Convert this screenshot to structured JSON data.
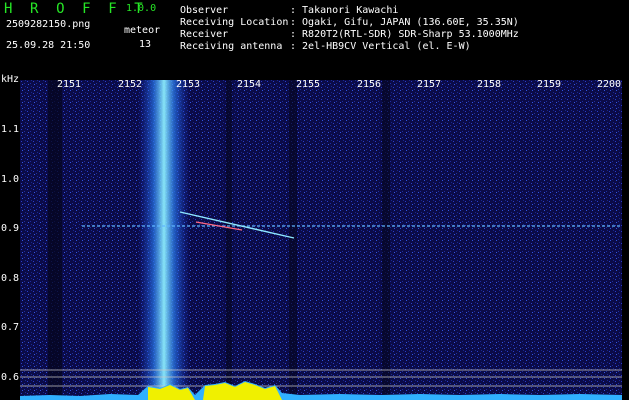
{
  "app": {
    "title": "H R O F F T",
    "version": "1.0.0"
  },
  "capture": {
    "filename": "2509282150.png",
    "timestamp": "25.09.28 21:50",
    "mode_label": "meteor",
    "count": "13"
  },
  "station": {
    "labels": [
      "Observer",
      "Receiving Location",
      "Receiver",
      "Receiving antenna"
    ],
    "values": [
      ": Takanori Kawachi",
      ": Ogaki, Gifu, JAPAN (136.60E, 35.35N)",
      ": R820T2(RTL-SDR) SDR-Sharp 53.1000MHz",
      ": 2el-HB9CV Vertical (el. E-W)"
    ]
  },
  "axes": {
    "y_unit": "kHz",
    "x_ticks": [
      "2151",
      "2152",
      "2153",
      "2154",
      "2155",
      "2156",
      "2157",
      "2158",
      "2159",
      "2200"
    ],
    "y_ticks": [
      "1.1",
      "1.0",
      "0.9",
      "0.8",
      "0.7",
      "0.6"
    ]
  },
  "colors": {
    "title": "#26e626",
    "background": "#0a0a40",
    "signal": "#6fd2ff",
    "amplitude": "#f0f000",
    "noise_trace": "#30b0ff"
  }
}
